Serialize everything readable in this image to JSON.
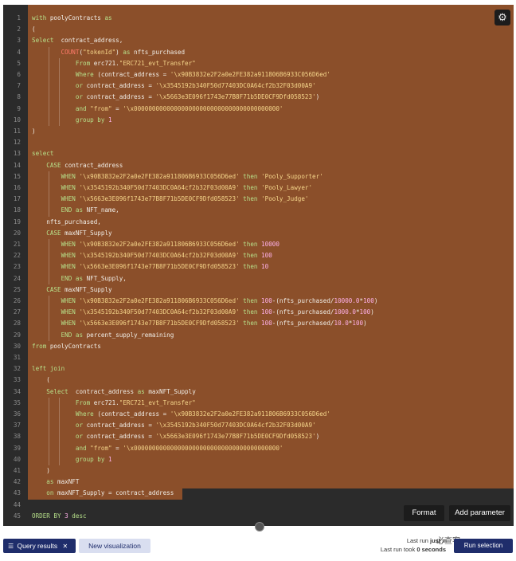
{
  "editor": {
    "lines": [
      {
        "n": "1",
        "tokens": [
          {
            "t": "with ",
            "c": "kw"
          },
          {
            "t": "poolyContracts ",
            "c": ""
          },
          {
            "t": "as",
            "c": "kw"
          }
        ]
      },
      {
        "n": "2",
        "tokens": [
          {
            "t": "(",
            "c": ""
          }
        ]
      },
      {
        "n": "3",
        "tokens": [
          {
            "t": "Select  ",
            "c": "kw"
          },
          {
            "t": "contract_address,",
            "c": ""
          }
        ]
      },
      {
        "n": "4",
        "tokens": [
          {
            "t": "        ",
            "c": ""
          },
          {
            "t": "COUNT",
            "c": "fn"
          },
          {
            "t": "(",
            "c": ""
          },
          {
            "t": "\"tokenId\"",
            "c": "str"
          },
          {
            "t": ") ",
            "c": ""
          },
          {
            "t": "as ",
            "c": "kw"
          },
          {
            "t": "nfts_purchased",
            "c": ""
          }
        ]
      },
      {
        "n": "5",
        "tokens": [
          {
            "t": "            ",
            "c": ""
          },
          {
            "t": "From ",
            "c": "kw"
          },
          {
            "t": "erc721.",
            "c": ""
          },
          {
            "t": "\"ERC721_evt_Transfer\"",
            "c": "str"
          }
        ]
      },
      {
        "n": "6",
        "tokens": [
          {
            "t": "            ",
            "c": ""
          },
          {
            "t": "Where ",
            "c": "kw"
          },
          {
            "t": "(contract_address = ",
            "c": ""
          },
          {
            "t": "'\\x90B3832e2F2a0e2FE382a911806B6933C056D6ed'",
            "c": "str"
          }
        ]
      },
      {
        "n": "7",
        "tokens": [
          {
            "t": "            ",
            "c": ""
          },
          {
            "t": "or ",
            "c": "kw"
          },
          {
            "t": "contract_address = ",
            "c": ""
          },
          {
            "t": "'\\x3545192b340F50d77403DC0A64cf2b32F03d00A9'",
            "c": "str"
          }
        ]
      },
      {
        "n": "8",
        "tokens": [
          {
            "t": "            ",
            "c": ""
          },
          {
            "t": "or ",
            "c": "kw"
          },
          {
            "t": "contract_address = ",
            "c": ""
          },
          {
            "t": "'\\x5663e3E096f1743e77B8F71b5DE0CF9Dfd058523'",
            "c": "str"
          },
          {
            "t": ")",
            "c": ""
          }
        ]
      },
      {
        "n": "9",
        "tokens": [
          {
            "t": "            ",
            "c": ""
          },
          {
            "t": "and ",
            "c": "kw"
          },
          {
            "t": "\"from\"",
            "c": "str"
          },
          {
            "t": " = ",
            "c": ""
          },
          {
            "t": "'\\x0000000000000000000000000000000000000000'",
            "c": "str"
          }
        ]
      },
      {
        "n": "10",
        "tokens": [
          {
            "t": "            ",
            "c": ""
          },
          {
            "t": "group by ",
            "c": "kw"
          },
          {
            "t": "1",
            "c": "num"
          }
        ]
      },
      {
        "n": "11",
        "tokens": [
          {
            "t": ")",
            "c": ""
          }
        ]
      },
      {
        "n": "12",
        "tokens": []
      },
      {
        "n": "13",
        "tokens": [
          {
            "t": "select",
            "c": "kw"
          }
        ]
      },
      {
        "n": "14",
        "tokens": [
          {
            "t": "    ",
            "c": ""
          },
          {
            "t": "CASE ",
            "c": "kw"
          },
          {
            "t": "contract_address",
            "c": ""
          }
        ]
      },
      {
        "n": "15",
        "tokens": [
          {
            "t": "        ",
            "c": ""
          },
          {
            "t": "WHEN ",
            "c": "kw"
          },
          {
            "t": "'\\x90B3832e2F2a0e2FE382a911806B6933C056D6ed'",
            "c": "str"
          },
          {
            "t": " then ",
            "c": "kw"
          },
          {
            "t": "'Pooly_Supporter'",
            "c": "str"
          }
        ]
      },
      {
        "n": "16",
        "tokens": [
          {
            "t": "        ",
            "c": ""
          },
          {
            "t": "WHEN ",
            "c": "kw"
          },
          {
            "t": "'\\x3545192b340F50d77403DC0A64cf2b32F03d00A9'",
            "c": "str"
          },
          {
            "t": " then ",
            "c": "kw"
          },
          {
            "t": "'Pooly_Lawyer'",
            "c": "str"
          }
        ]
      },
      {
        "n": "17",
        "tokens": [
          {
            "t": "        ",
            "c": ""
          },
          {
            "t": "WHEN ",
            "c": "kw"
          },
          {
            "t": "'\\x5663e3E096f1743e77B8F71b5DE0CF9Dfd058523'",
            "c": "str"
          },
          {
            "t": " then ",
            "c": "kw"
          },
          {
            "t": "'Pooly_Judge'",
            "c": "str"
          }
        ]
      },
      {
        "n": "18",
        "tokens": [
          {
            "t": "        ",
            "c": ""
          },
          {
            "t": "END ",
            "c": "kw"
          },
          {
            "t": "as ",
            "c": "kw"
          },
          {
            "t": "NFT_name,",
            "c": ""
          }
        ]
      },
      {
        "n": "19",
        "tokens": [
          {
            "t": "    nfts_purchased,",
            "c": ""
          }
        ]
      },
      {
        "n": "20",
        "tokens": [
          {
            "t": "    ",
            "c": ""
          },
          {
            "t": "CASE ",
            "c": "kw"
          },
          {
            "t": "maxNFT_Supply",
            "c": ""
          }
        ]
      },
      {
        "n": "21",
        "tokens": [
          {
            "t": "        ",
            "c": ""
          },
          {
            "t": "WHEN ",
            "c": "kw"
          },
          {
            "t": "'\\x90B3832e2F2a0e2FE382a911806B6933C056D6ed'",
            "c": "str"
          },
          {
            "t": " then ",
            "c": "kw"
          },
          {
            "t": "10000",
            "c": "num"
          }
        ]
      },
      {
        "n": "22",
        "tokens": [
          {
            "t": "        ",
            "c": ""
          },
          {
            "t": "WHEN ",
            "c": "kw"
          },
          {
            "t": "'\\x3545192b340F50d77403DC0A64cf2b32F03d00A9'",
            "c": "str"
          },
          {
            "t": " then ",
            "c": "kw"
          },
          {
            "t": "100",
            "c": "num"
          }
        ]
      },
      {
        "n": "23",
        "tokens": [
          {
            "t": "        ",
            "c": ""
          },
          {
            "t": "WHEN ",
            "c": "kw"
          },
          {
            "t": "'\\x5663e3E096f1743e77B8F71b5DE0CF9Dfd058523'",
            "c": "str"
          },
          {
            "t": " then ",
            "c": "kw"
          },
          {
            "t": "10",
            "c": "num"
          }
        ]
      },
      {
        "n": "24",
        "tokens": [
          {
            "t": "        ",
            "c": ""
          },
          {
            "t": "END ",
            "c": "kw"
          },
          {
            "t": "as ",
            "c": "kw"
          },
          {
            "t": "NFT_Supply,",
            "c": ""
          }
        ]
      },
      {
        "n": "25",
        "tokens": [
          {
            "t": "    ",
            "c": ""
          },
          {
            "t": "CASE ",
            "c": "kw"
          },
          {
            "t": "maxNFT_Supply",
            "c": ""
          }
        ]
      },
      {
        "n": "26",
        "tokens": [
          {
            "t": "        ",
            "c": ""
          },
          {
            "t": "WHEN ",
            "c": "kw"
          },
          {
            "t": "'\\x90B3832e2F2a0e2FE382a911806B6933C056D6ed'",
            "c": "str"
          },
          {
            "t": " then ",
            "c": "kw"
          },
          {
            "t": "100",
            "c": "num"
          },
          {
            "t": "-(nfts_purchased/",
            "c": ""
          },
          {
            "t": "10000.0",
            "c": "num"
          },
          {
            "t": "*",
            "c": ""
          },
          {
            "t": "100",
            "c": "num"
          },
          {
            "t": ")",
            "c": ""
          }
        ]
      },
      {
        "n": "27",
        "tokens": [
          {
            "t": "        ",
            "c": ""
          },
          {
            "t": "WHEN ",
            "c": "kw"
          },
          {
            "t": "'\\x3545192b340F50d77403DC0A64cf2b32F03d00A9'",
            "c": "str"
          },
          {
            "t": " then ",
            "c": "kw"
          },
          {
            "t": "100",
            "c": "num"
          },
          {
            "t": "-(nfts_purchased/",
            "c": ""
          },
          {
            "t": "1000.0",
            "c": "num"
          },
          {
            "t": "*",
            "c": ""
          },
          {
            "t": "100",
            "c": "num"
          },
          {
            "t": ")",
            "c": ""
          }
        ]
      },
      {
        "n": "28",
        "tokens": [
          {
            "t": "        ",
            "c": ""
          },
          {
            "t": "WHEN ",
            "c": "kw"
          },
          {
            "t": "'\\x5663e3E096f1743e77B8F71b5DE0CF9Dfd058523'",
            "c": "str"
          },
          {
            "t": " then ",
            "c": "kw"
          },
          {
            "t": "100",
            "c": "num"
          },
          {
            "t": "-(nfts_purchased/",
            "c": ""
          },
          {
            "t": "10.0",
            "c": "num"
          },
          {
            "t": "*",
            "c": ""
          },
          {
            "t": "100",
            "c": "num"
          },
          {
            "t": ")",
            "c": ""
          }
        ]
      },
      {
        "n": "29",
        "tokens": [
          {
            "t": "        ",
            "c": ""
          },
          {
            "t": "END ",
            "c": "kw"
          },
          {
            "t": "as ",
            "c": "kw"
          },
          {
            "t": "percent_supply_remaining",
            "c": ""
          }
        ]
      },
      {
        "n": "30",
        "tokens": [
          {
            "t": "from ",
            "c": "kw"
          },
          {
            "t": "poolyContracts",
            "c": ""
          }
        ]
      },
      {
        "n": "31",
        "tokens": []
      },
      {
        "n": "32",
        "tokens": [
          {
            "t": "left join",
            "c": "kw"
          }
        ]
      },
      {
        "n": "33",
        "tokens": [
          {
            "t": "    (",
            "c": ""
          }
        ]
      },
      {
        "n": "34",
        "tokens": [
          {
            "t": "    ",
            "c": ""
          },
          {
            "t": "Select  ",
            "c": "kw"
          },
          {
            "t": "contract_address ",
            "c": ""
          },
          {
            "t": "as ",
            "c": "kw"
          },
          {
            "t": "maxNFT_Supply",
            "c": ""
          }
        ]
      },
      {
        "n": "35",
        "tokens": [
          {
            "t": "            ",
            "c": ""
          },
          {
            "t": "From ",
            "c": "kw"
          },
          {
            "t": "erc721.",
            "c": ""
          },
          {
            "t": "\"ERC721_evt_Transfer\"",
            "c": "str"
          }
        ]
      },
      {
        "n": "36",
        "tokens": [
          {
            "t": "            ",
            "c": ""
          },
          {
            "t": "Where ",
            "c": "kw"
          },
          {
            "t": "(contract_address = ",
            "c": ""
          },
          {
            "t": "'\\x90B3832e2F2a0e2FE382a911806B6933C056D6ed'",
            "c": "str"
          }
        ]
      },
      {
        "n": "37",
        "tokens": [
          {
            "t": "            ",
            "c": ""
          },
          {
            "t": "or ",
            "c": "kw"
          },
          {
            "t": "contract_address = ",
            "c": ""
          },
          {
            "t": "'\\x3545192b340F50d77403DC0A64cf2b32F03d00A9'",
            "c": "str"
          }
        ]
      },
      {
        "n": "38",
        "tokens": [
          {
            "t": "            ",
            "c": ""
          },
          {
            "t": "or ",
            "c": "kw"
          },
          {
            "t": "contract_address = ",
            "c": ""
          },
          {
            "t": "'\\x5663e3E096f1743e77B8F71b5DE0CF9Dfd058523'",
            "c": "str"
          },
          {
            "t": ")",
            "c": ""
          }
        ]
      },
      {
        "n": "39",
        "tokens": [
          {
            "t": "            ",
            "c": ""
          },
          {
            "t": "and ",
            "c": "kw"
          },
          {
            "t": "\"from\"",
            "c": "str"
          },
          {
            "t": " = ",
            "c": ""
          },
          {
            "t": "'\\x0000000000000000000000000000000000000000'",
            "c": "str"
          }
        ]
      },
      {
        "n": "40",
        "tokens": [
          {
            "t": "            ",
            "c": ""
          },
          {
            "t": "group by ",
            "c": "kw"
          },
          {
            "t": "1",
            "c": "num"
          }
        ]
      },
      {
        "n": "41",
        "tokens": [
          {
            "t": "    )",
            "c": ""
          }
        ]
      },
      {
        "n": "42",
        "tokens": [
          {
            "t": "    ",
            "c": ""
          },
          {
            "t": "as ",
            "c": "kw"
          },
          {
            "t": "maxNFT",
            "c": ""
          }
        ]
      },
      {
        "n": "43",
        "tokens": [
          {
            "t": "    ",
            "c": ""
          },
          {
            "t": "on ",
            "c": "kw"
          },
          {
            "t": "maxNFT_Supply = contract_address",
            "c": ""
          }
        ]
      },
      {
        "n": "44",
        "tokens": []
      },
      {
        "n": "45",
        "tokens": [
          {
            "t": "ORDER BY ",
            "c": "kw"
          },
          {
            "t": "3",
            "c": "num"
          },
          {
            "t": " desc",
            "c": "kw"
          }
        ]
      }
    ]
  },
  "editor_toolbar": {
    "settings_icon": "gear-icon",
    "format_label": "Format",
    "add_parameter_label": "Add parameter"
  },
  "bottom": {
    "tab_query_results": "Query results",
    "tab_query_results_icon": "list-icon",
    "tab_close_icon": "close-icon",
    "tab_new_visualization": "New visualization",
    "last_run_prefix": "Last run ",
    "last_run_value": "just n",
    "last_run_took_prefix": "Last run took ",
    "last_run_took_value": "0 seconds",
    "run_button_label": "Run selection",
    "watermark": "必查客"
  },
  "colors": {
    "editor_bg": "#2b2b2b",
    "selection": "#8b4f2a",
    "keyword": "#b7e08a",
    "function": "#ff7a6a",
    "string": "#f5d58a",
    "number": "#ffb0e8",
    "primary_button": "#1f2d6b"
  }
}
